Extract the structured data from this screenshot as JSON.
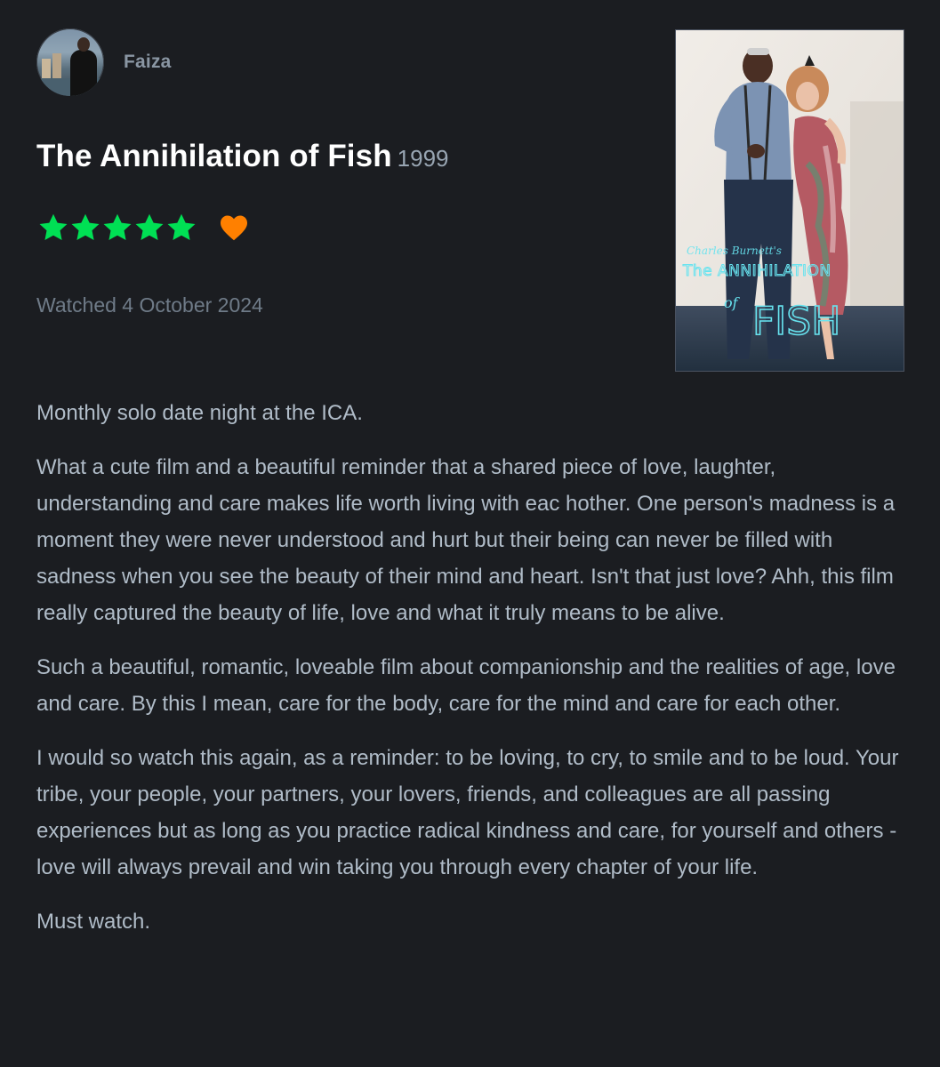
{
  "author": {
    "name": "Faiza"
  },
  "film": {
    "title": "The Annihilation of Fish",
    "year": "1999"
  },
  "rating": {
    "stars": 5,
    "max_stars": 5,
    "liked": true,
    "star_color": "#00e054",
    "heart_color": "#ff8000"
  },
  "watched": {
    "text": "Watched 4 October 2024"
  },
  "poster": {
    "credit": "Charles Burnett's",
    "title_line1": "The ANNIHILATION",
    "title_line2_small": "of",
    "title_line2_big": "FISH"
  },
  "review": {
    "paragraphs": [
      "Monthly solo date night at the ICA.",
      "What a cute film and a beautiful reminder that a shared piece of love, laughter, understanding and care makes life worth living with eac hother. One person's madness is a moment they were never understood and hurt but their being can never be filled with sadness when you see the beauty of their mind and heart. Isn't that just love? Ahh, this film really captured the beauty of life, love and what it truly means to be alive.",
      "Such a beautiful, romantic, loveable film about companionship and the realities of age, love and care. By this I mean, care for the body, care for the mind and care for each other.",
      "I would so watch this again, as a reminder: to be loving, to cry, to smile and to be loud. Your tribe, your people, your partners, your lovers, friends, and colleagues are all passing experiences but as long as you practice radical kindness and care, for yourself and others - love will always prevail and win taking you through every chapter of your life.",
      "Must watch."
    ]
  },
  "colors": {
    "background": "#1b1d21",
    "title": "#ffffff",
    "body_text": "#b0bcc8",
    "muted_text": "#6f7b88"
  }
}
